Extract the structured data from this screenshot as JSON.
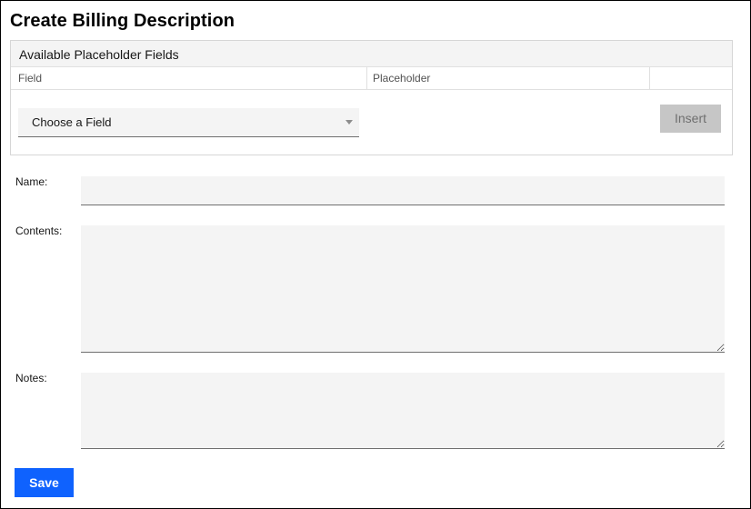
{
  "page": {
    "title": "Create Billing Description"
  },
  "placeholder_panel": {
    "header": "Available Placeholder Fields",
    "columns": {
      "field": "Field",
      "placeholder": "Placeholder",
      "action": ""
    },
    "field_select": {
      "selected": "Choose a Field"
    },
    "insert_label": "Insert",
    "insert_enabled": false
  },
  "form": {
    "name_label": "Name:",
    "name_value": "",
    "contents_label": "Contents:",
    "contents_value": "",
    "notes_label": "Notes:",
    "notes_value": "",
    "save_label": "Save"
  },
  "colors": {
    "primary": "#0f62fe",
    "field_bg": "#f4f4f4",
    "disabled_bg": "#c6c6c6",
    "border": "#e0e0e0"
  }
}
